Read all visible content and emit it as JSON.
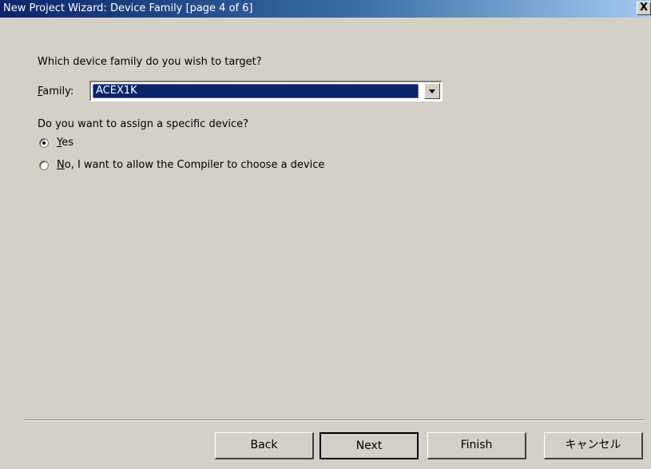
{
  "window": {
    "title": "New Project Wizard: Device Family [page 4 of 6]",
    "close_label": "X"
  },
  "family_question": "Which device family do you wish to target?",
  "family": {
    "label_prefix": "",
    "label_accel": "F",
    "label_rest": "amily:",
    "selected": "ACEX1K"
  },
  "device_question": "Do you want to assign a specific device?",
  "radios": [
    {
      "accel": "Y",
      "rest": "es",
      "checked": true
    },
    {
      "accel": "N",
      "rest": "o, I want to allow the Compiler to choose a device",
      "checked": false
    }
  ],
  "buttons": {
    "back": "Back",
    "next": "Next",
    "finish": "Finish",
    "cancel": "キャンセル"
  }
}
